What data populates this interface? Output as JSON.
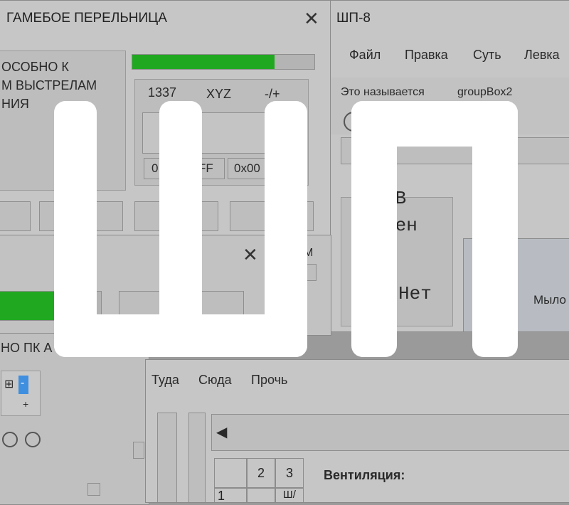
{
  "window1": {
    "title": "ГАМЕБОЕ ПЕРЕЛЬНИЦА",
    "close": "✕",
    "text_lines": [
      "ОСОБНО К",
      "М ВЫСТРЕЛАМ",
      "НИЯ"
    ],
    "progress": 0.78,
    "tabs": [
      "1337",
      "XYZ",
      "-/+"
    ],
    "fields": [
      "0",
      "FF",
      "0x00"
    ]
  },
  "window2": {
    "title": "ШП-8",
    "menu": [
      "Файл",
      "Правка",
      "Суть",
      "Левка"
    ],
    "labels": [
      "Это называется",
      "groupBox2"
    ],
    "group_text_1": "рВ",
    "group_text_2": "рен",
    "group_text_3": "Нет",
    "side_label": "Мыло"
  },
  "window3": {
    "close": "✕",
    "small_letter": "М",
    "label": "НО ПК А",
    "tree_plus": "⊞",
    "tree_minus": "-",
    "tree_plus2": "+",
    "progress": 0.72
  },
  "window4": {
    "menu": [
      "Туда",
      "Сюда",
      "Прочь"
    ],
    "grid_headers": [
      "2",
      "3"
    ],
    "grid_row": [
      "1",
      "",
      "Ш/"
    ],
    "ventilation_label": "Вентиляция:",
    "scroll_arrow": "◀"
  },
  "logo": {
    "text": "ШП"
  },
  "colors": {
    "progress_green": "#21a821",
    "overlay_white": "#ffffff"
  }
}
